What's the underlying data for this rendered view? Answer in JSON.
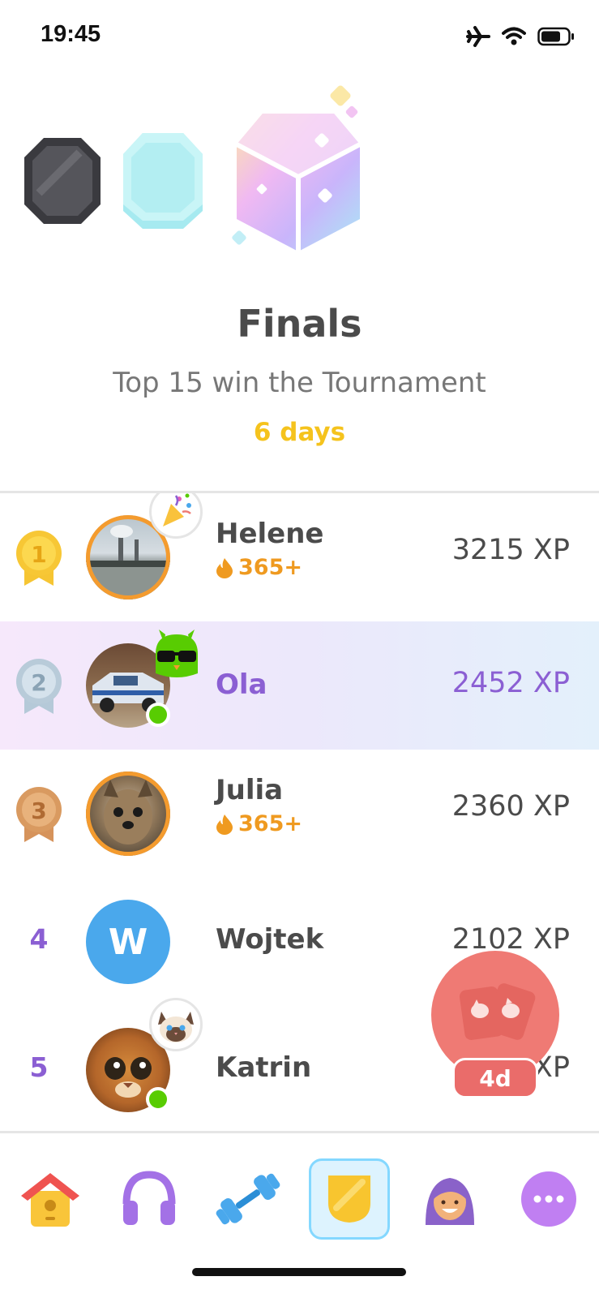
{
  "status": {
    "time": "19:45"
  },
  "league": {
    "title": "Finals",
    "subtitle": "Top 15 win the Tournament",
    "countdown": "6 days"
  },
  "leaderboard": [
    {
      "rank": "1",
      "name": "Helene",
      "streak": "365+",
      "xp": "3215 XP",
      "medal": "gold"
    },
    {
      "rank": "2",
      "name": "Ola",
      "streak": "",
      "xp": "2452 XP",
      "medal": "silver",
      "current_user": true
    },
    {
      "rank": "3",
      "name": "Julia",
      "streak": "365+",
      "xp": "2360 XP",
      "medal": "bronze"
    },
    {
      "rank": "4",
      "name": "Wojtek",
      "avatar_letter": "W",
      "xp": "2102 XP"
    },
    {
      "rank": "5",
      "name": "Katrin",
      "xp": "XP"
    }
  ],
  "friends_quest": {
    "time_left": "4d"
  },
  "tabs": [
    {
      "name": "home-tab",
      "icon": "house-icon"
    },
    {
      "name": "listening-tab",
      "icon": "headphones-icon"
    },
    {
      "name": "practice-tab",
      "icon": "dumbbell-icon"
    },
    {
      "name": "leagues-tab",
      "icon": "shield-icon",
      "active": true
    },
    {
      "name": "profile-tab",
      "icon": "profile-avatar-icon"
    },
    {
      "name": "more-tab",
      "icon": "more-dots-icon"
    }
  ],
  "colors": {
    "accent_purple": "#8b5fd3",
    "streak_orange": "#ef9a20",
    "countdown_yellow": "#f5c31d",
    "active_tab_border": "#84d8ff"
  }
}
